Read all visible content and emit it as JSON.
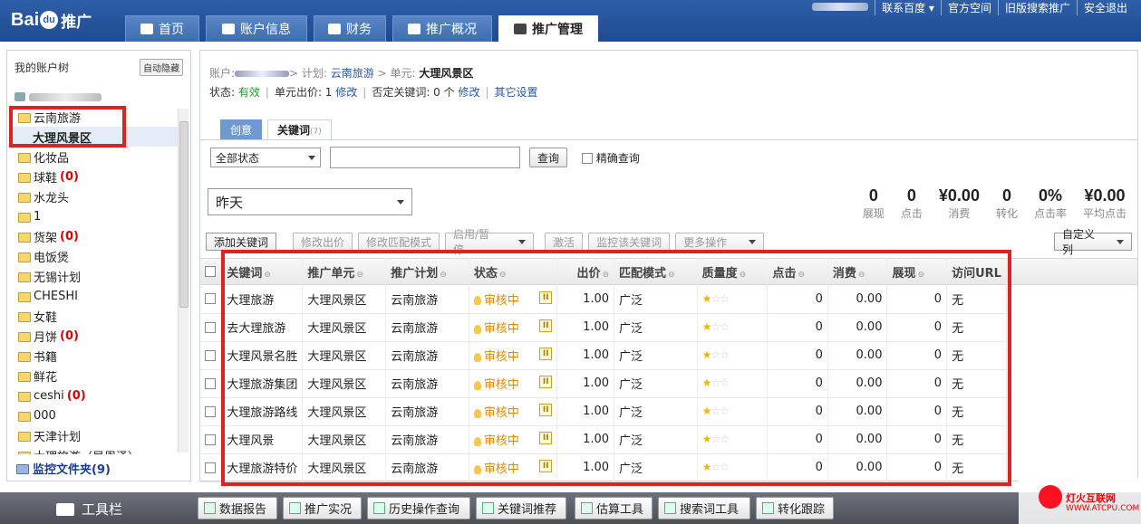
{
  "header": {
    "logo_text": "Bai",
    "logo_paw": "du",
    "logo_suffix": "推广",
    "tabs": [
      {
        "label": "首页",
        "icon": "home-icon"
      },
      {
        "label": "账户信息",
        "icon": "user-icon"
      },
      {
        "label": "财务",
        "icon": "card-icon"
      },
      {
        "label": "推广概况",
        "icon": "chart-icon"
      },
      {
        "label": "推广管理",
        "icon": "grid-icon"
      }
    ],
    "links": [
      "联系百度",
      "官方空间",
      "旧版搜索推广",
      "安全退出"
    ]
  },
  "sidebar": {
    "title": "我的账户树",
    "autohide": "自动隐藏",
    "tree": [
      {
        "label": "云南旅游"
      },
      {
        "label": "大理风景区"
      },
      {
        "label": "化妆品"
      },
      {
        "label": "球鞋",
        "count": "(0)"
      },
      {
        "label": "水龙头"
      },
      {
        "label": "1"
      },
      {
        "label": "货架",
        "count": "(0)"
      },
      {
        "label": "电饭煲"
      },
      {
        "label": "无锡计划"
      },
      {
        "label": "CHESHI"
      },
      {
        "label": "女鞋"
      },
      {
        "label": "月饼",
        "count": "(0)"
      },
      {
        "label": "书籍"
      },
      {
        "label": "鲜花"
      },
      {
        "label": "ceshi",
        "count": "(0)"
      },
      {
        "label": "000"
      },
      {
        "label": "天津计划"
      },
      {
        "label": "大理旅游（吴周泽）"
      }
    ],
    "footer": "监控文件夹(9)"
  },
  "breadcrumb": {
    "account": "账户:",
    "plan_label": "> 计划:",
    "plan": "云南旅游",
    "unit_label": "> 单元:",
    "unit": "大理风景区"
  },
  "status": {
    "label": "状态:",
    "value": "有效",
    "bid_label": "单元出价: 1",
    "edit": "修改",
    "neg_label": "否定关键词: 0 个",
    "other": "其它设置"
  },
  "subtabs": {
    "creative": "创意",
    "keywords": "关键词",
    "kw_count": "(7)"
  },
  "filter": {
    "status_select": "全部状态",
    "query_btn": "查询",
    "exact": "精确查询"
  },
  "date_select": "昨天",
  "stats": [
    {
      "v": "0",
      "l": "展现"
    },
    {
      "v": "0",
      "l": "点击"
    },
    {
      "v": "¥0.00",
      "l": "消费"
    },
    {
      "v": "0",
      "l": "转化"
    },
    {
      "v": "0%",
      "l": "点击率"
    },
    {
      "v": "¥0.00",
      "l": "平均点击"
    }
  ],
  "toolbar": {
    "add": "添加关键词",
    "edit_bid": "修改出价",
    "edit_match": "修改匹配模式",
    "enable": "启用/暂停",
    "activate": "激活",
    "monitor": "监控该关键词",
    "more": "更多操作",
    "custom": "自定义列"
  },
  "table": {
    "headers": [
      "关键词",
      "推广单元",
      "推广计划",
      "状态",
      "出价",
      "匹配模式",
      "质量度",
      "点击",
      "消费",
      "展现",
      "访问URL"
    ],
    "rows": [
      {
        "kw": "大理旅游",
        "unit": "大理风景区",
        "plan": "云南旅游",
        "status": "审核中",
        "bid": "1.00",
        "match": "广泛",
        "clicks": "0",
        "cost": "0.00",
        "imp": "0",
        "url": "无"
      },
      {
        "kw": "去大理旅游",
        "unit": "大理风景区",
        "plan": "云南旅游",
        "status": "审核中",
        "bid": "1.00",
        "match": "广泛",
        "clicks": "0",
        "cost": "0.00",
        "imp": "0",
        "url": "无"
      },
      {
        "kw": "大理风景名胜",
        "unit": "大理风景区",
        "plan": "云南旅游",
        "status": "审核中",
        "bid": "1.00",
        "match": "广泛",
        "clicks": "0",
        "cost": "0.00",
        "imp": "0",
        "url": "无"
      },
      {
        "kw": "大理旅游集团",
        "unit": "大理风景区",
        "plan": "云南旅游",
        "status": "审核中",
        "bid": "1.00",
        "match": "广泛",
        "clicks": "0",
        "cost": "0.00",
        "imp": "0",
        "url": "无"
      },
      {
        "kw": "大理旅游路线",
        "unit": "大理风景区",
        "plan": "云南旅游",
        "status": "审核中",
        "bid": "1.00",
        "match": "广泛",
        "clicks": "0",
        "cost": "0.00",
        "imp": "0",
        "url": "无"
      },
      {
        "kw": "大理风景",
        "unit": "大理风景区",
        "plan": "云南旅游",
        "status": "审核中",
        "bid": "1.00",
        "match": "广泛",
        "clicks": "0",
        "cost": "0.00",
        "imp": "0",
        "url": "无"
      },
      {
        "kw": "大理旅游特价",
        "unit": "大理风景区",
        "plan": "云南旅游",
        "status": "审核中",
        "bid": "1.00",
        "match": "广泛",
        "clicks": "0",
        "cost": "0.00",
        "imp": "0",
        "url": "无"
      }
    ]
  },
  "bottom": {
    "title": "工具栏",
    "buttons": [
      "数据报告",
      "推广实况",
      "历史操作查询",
      "关键词推荐",
      "估算工具",
      "搜索词工具",
      "转化跟踪"
    ]
  },
  "watermark": {
    "line1": "灯火互联网",
    "line2": "WWW.ATCPU.COM"
  }
}
